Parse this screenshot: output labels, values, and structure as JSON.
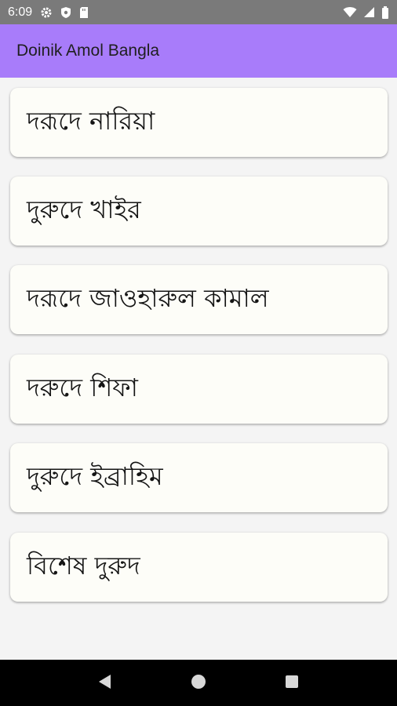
{
  "status_bar": {
    "time": "6:09",
    "icons": [
      "gear-icon",
      "shield-icon",
      "sd-card-icon",
      "wifi-icon",
      "signal-icon",
      "battery-icon"
    ]
  },
  "app_bar": {
    "title": "Doinik Amol Bangla",
    "color": "#a87cfa"
  },
  "list": {
    "items": [
      {
        "label": "দরূদে নারিয়া"
      },
      {
        "label": "দুরুদে খাইর"
      },
      {
        "label": "দরূদে জাওহারুল কামাল"
      },
      {
        "label": "দরুদে শিফা"
      },
      {
        "label": "দুরুদে ইব্রাহিম"
      },
      {
        "label": "বিশেষ দুরুদ"
      }
    ]
  },
  "nav_bar": {
    "buttons": [
      "back-icon",
      "home-icon",
      "recents-icon"
    ]
  }
}
